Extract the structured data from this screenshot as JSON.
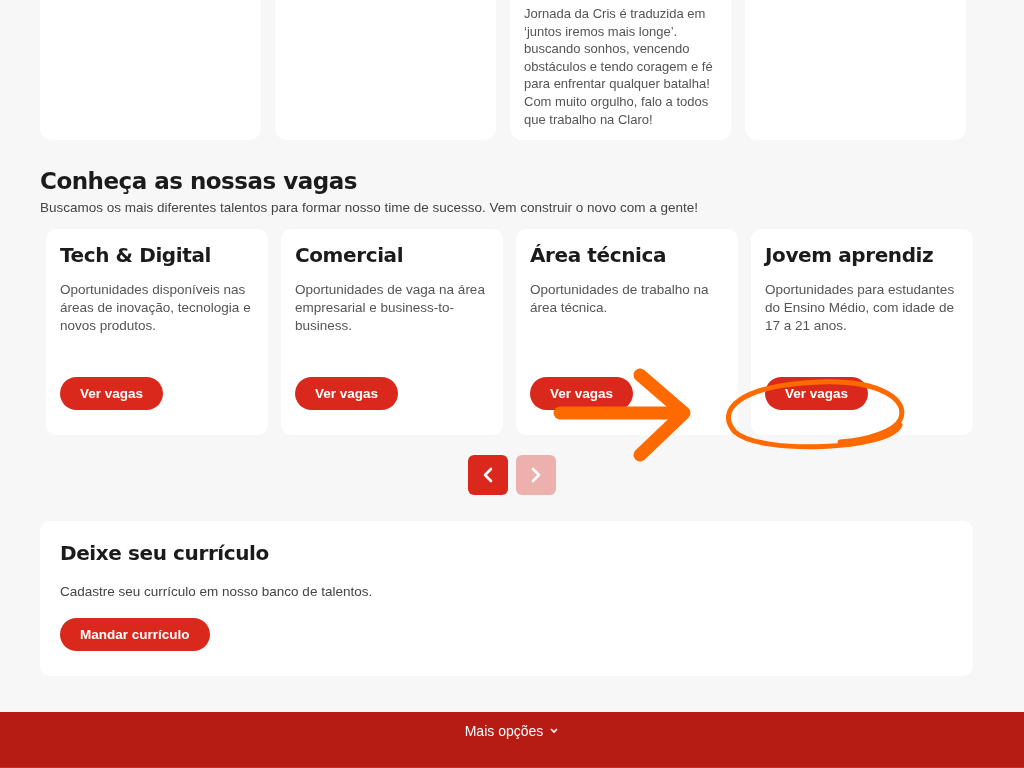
{
  "testimonials": [
    {
      "kind": "blank"
    },
    {
      "kind": "blank"
    },
    {
      "kind": "quote",
      "text": "Jornada da Cris é traduzida em ‘juntos iremos mais longe’. buscando sonhos, vencendo obstáculos e tendo coragem e fé para enfrentar qualquer batalha! Com muito orgulho, falo a todos que trabalho na Claro!"
    },
    {
      "kind": "blank"
    }
  ],
  "jobs_section": {
    "title": "Conheça as nossas vagas",
    "subtitle": "Buscamos os mais diferentes talentos para formar nosso time de sucesso. Vem construir o novo com a gente!",
    "cards": [
      {
        "title": "Tech & Digital",
        "description": "Oportunidades disponíveis nas áreas de inovação, tecnologia e novos produtos.",
        "button": "Ver vagas"
      },
      {
        "title": "Comercial",
        "description": "Oportunidades de vaga na área empresarial e business-to-business.",
        "button": "Ver vagas"
      },
      {
        "title": "Área técnica",
        "description": "Oportunidades de trabalho na área técnica.",
        "button": "Ver vagas"
      },
      {
        "title": "Jovem aprendiz",
        "description": "Oportunidades para estudantes do Ensino Médio, com idade de 17 a 21 anos.",
        "button": "Ver vagas"
      }
    ],
    "pager": {
      "previous_disabled": false,
      "next_disabled": true
    }
  },
  "resume": {
    "title": "Deixe seu currículo",
    "text": "Cadastre seu currículo em nosso banco de talentos.",
    "button": "Mandar currículo"
  },
  "footer": {
    "label": "Mais opções"
  }
}
